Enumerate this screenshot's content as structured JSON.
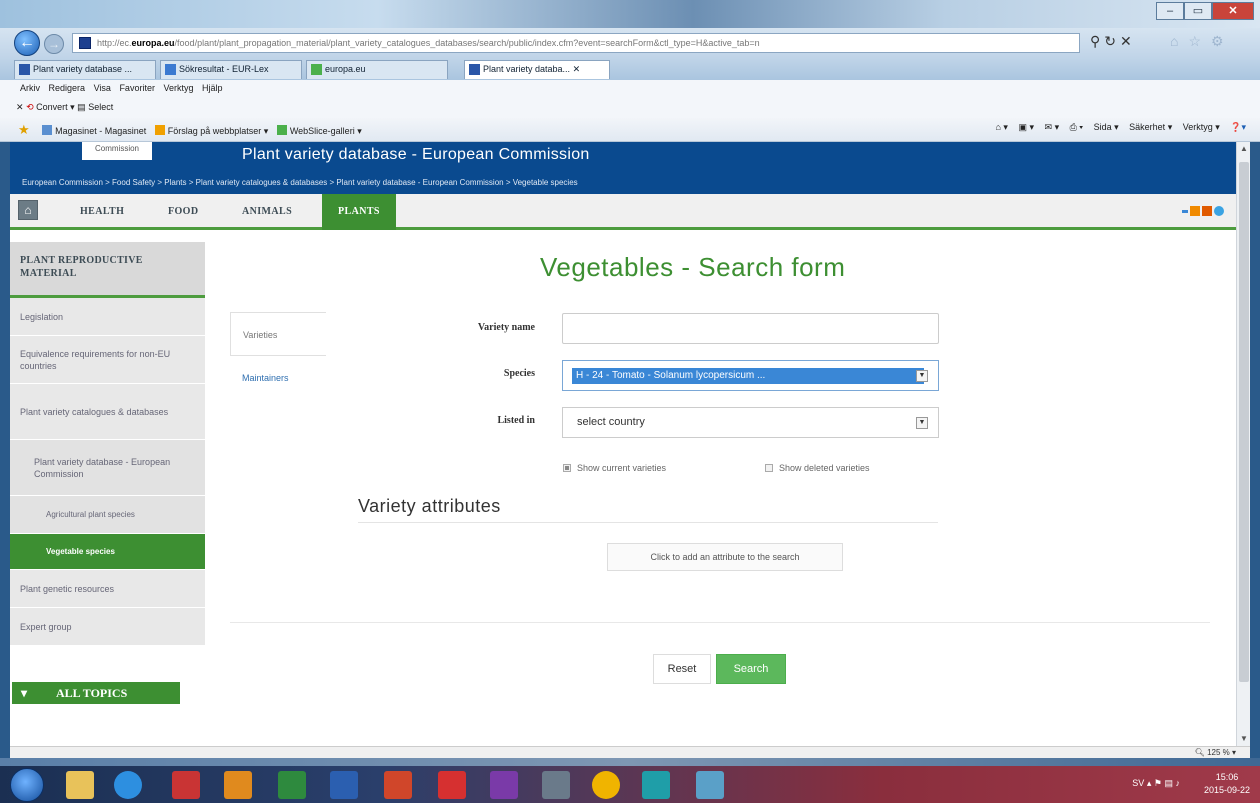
{
  "browser": {
    "url_prefix": "http://ec.",
    "url_domain": "europa.eu",
    "url_path": "/food/plant/plant_propagation_material/plant_variety_catalogues_databases/search/public/index.cfm?event=searchForm&ctl_type=H&active_tab=n",
    "tabs": [
      {
        "label": "Plant variety database ..."
      },
      {
        "label": "Sökresultat - EUR-Lex"
      },
      {
        "label": "europa.eu"
      },
      {
        "label": "Plant variety databa..."
      }
    ],
    "menu": [
      "Arkiv",
      "Redigera",
      "Visa",
      "Favoriter",
      "Verktyg",
      "Hjälp"
    ],
    "convert": "Convert",
    "select": "Select",
    "favorites": [
      "Magasinet - Magasinet",
      "Förslag på webbplatser",
      "WebSlice-galleri"
    ],
    "commands": [
      "Sida",
      "Säkerhet",
      "Verktyg"
    ],
    "zoom": "125 %"
  },
  "site": {
    "logo_text": "Commission",
    "title": "Plant variety database - European Commission",
    "breadcrumb": "European Commission > Food Safety > Plants > Plant variety catalogues & databases > Plant variety database - European Commission > Vegetable species"
  },
  "nav": {
    "items": [
      {
        "label": "HEALTH"
      },
      {
        "label": "FOOD"
      },
      {
        "label": "ANIMALS"
      },
      {
        "label": "PLANTS"
      }
    ]
  },
  "sidebar": {
    "heading": "PLANT REPRODUCTIVE MATERIAL",
    "items": [
      {
        "label": "Legislation"
      },
      {
        "label": "Equivalence requirements for non-EU countries"
      },
      {
        "label": "Plant variety catalogues & databases"
      },
      {
        "label": "Plant variety database - European Commission"
      },
      {
        "label": "Agricultural plant species"
      },
      {
        "label": "Vegetable species"
      },
      {
        "label": "Plant genetic resources"
      },
      {
        "label": "Expert group"
      }
    ],
    "all_topics": "ALL TOPICS"
  },
  "main": {
    "title": "Vegetables - Search form",
    "tabs": [
      {
        "label": "Varieties"
      },
      {
        "label": "Maintainers"
      }
    ],
    "form": {
      "variety_name_label": "Variety name",
      "variety_name_value": "",
      "species_label": "Species",
      "species_value": "H - 24 - Tomato - Solanum lycopersicum ...",
      "listed_in_label": "Listed in",
      "listed_in_value": "select country",
      "show_current": "Show current varieties",
      "show_deleted": "Show deleted varieties"
    },
    "attributes_title": "Variety attributes",
    "add_attribute": "Click to add an attribute to the search",
    "reset": "Reset",
    "search": "Search"
  },
  "taskbar": {
    "lang": "SV",
    "time": "15:06",
    "date": "2015-09-22"
  },
  "colors": {
    "ec_blue": "#0a4a8f",
    "green": "#3d8f32",
    "search_green": "#5cb85c",
    "select_highlight": "#3a87d6"
  }
}
